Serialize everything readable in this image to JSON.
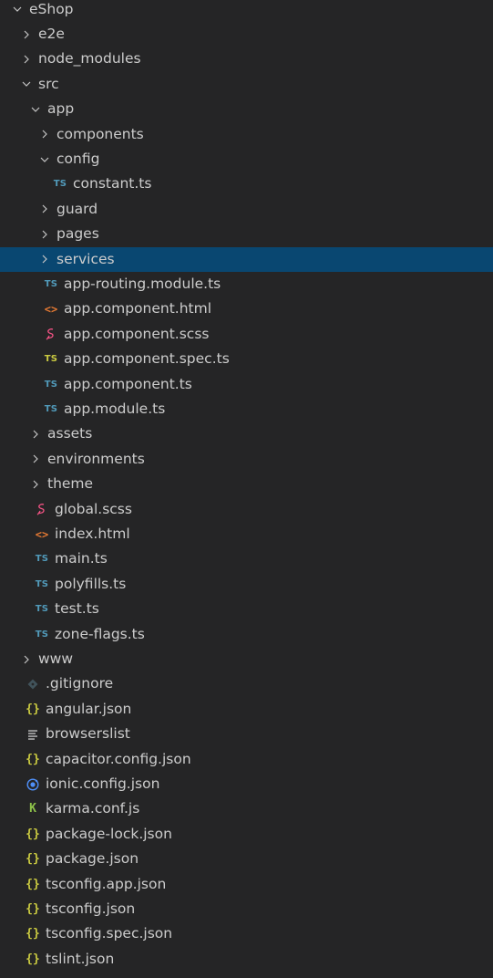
{
  "colors": {
    "background": "#252526",
    "selected": "#094771",
    "text": "#cccccc",
    "ts_blue": "#519aba",
    "ts_yellow": "#cbcb41",
    "json_yellow": "#cbcb41",
    "html_orange": "#e37933",
    "scss_pink": "#f55385",
    "karma_green": "#8dc149",
    "ionic_blue": "#4f8ff7"
  },
  "tree": [
    {
      "label": "eShop",
      "depth": 0,
      "kind": "folder",
      "open": true
    },
    {
      "label": "e2e",
      "depth": 1,
      "kind": "folder",
      "open": false
    },
    {
      "label": "node_modules",
      "depth": 1,
      "kind": "folder",
      "open": false
    },
    {
      "label": "src",
      "depth": 1,
      "kind": "folder",
      "open": true
    },
    {
      "label": "app",
      "depth": 2,
      "kind": "folder",
      "open": true
    },
    {
      "label": "components",
      "depth": 3,
      "kind": "folder",
      "open": false
    },
    {
      "label": "config",
      "depth": 3,
      "kind": "folder",
      "open": true
    },
    {
      "label": "constant.ts",
      "depth": 4,
      "kind": "file",
      "icon": "ts-icon",
      "icon_text": "TS",
      "icon_color": "#519aba"
    },
    {
      "label": "guard",
      "depth": 3,
      "kind": "folder",
      "open": false
    },
    {
      "label": "pages",
      "depth": 3,
      "kind": "folder",
      "open": false
    },
    {
      "label": "services",
      "depth": 3,
      "kind": "folder",
      "open": false,
      "selected": true
    },
    {
      "label": "app-routing.module.ts",
      "depth": 3,
      "kind": "file",
      "icon": "ts-icon",
      "icon_text": "TS",
      "icon_color": "#519aba"
    },
    {
      "label": "app.component.html",
      "depth": 3,
      "kind": "file",
      "icon": "html-icon",
      "icon_text": "<>",
      "icon_color": "#e37933"
    },
    {
      "label": "app.component.scss",
      "depth": 3,
      "kind": "file",
      "icon": "scss-icon",
      "icon_color": "#f55385"
    },
    {
      "label": "app.component.spec.ts",
      "depth": 3,
      "kind": "file",
      "icon": "spec-ts-icon",
      "icon_text": "TS",
      "icon_color": "#cbcb41"
    },
    {
      "label": "app.component.ts",
      "depth": 3,
      "kind": "file",
      "icon": "ts-icon",
      "icon_text": "TS",
      "icon_color": "#519aba"
    },
    {
      "label": "app.module.ts",
      "depth": 3,
      "kind": "file",
      "icon": "ts-icon",
      "icon_text": "TS",
      "icon_color": "#519aba"
    },
    {
      "label": "assets",
      "depth": 2,
      "kind": "folder",
      "open": false
    },
    {
      "label": "environments",
      "depth": 2,
      "kind": "folder",
      "open": false
    },
    {
      "label": "theme",
      "depth": 2,
      "kind": "folder",
      "open": false
    },
    {
      "label": "global.scss",
      "depth": 2,
      "kind": "file",
      "icon": "scss-icon",
      "icon_color": "#f55385"
    },
    {
      "label": "index.html",
      "depth": 2,
      "kind": "file",
      "icon": "html-icon",
      "icon_text": "<>",
      "icon_color": "#e37933"
    },
    {
      "label": "main.ts",
      "depth": 2,
      "kind": "file",
      "icon": "ts-icon",
      "icon_text": "TS",
      "icon_color": "#519aba"
    },
    {
      "label": "polyfills.ts",
      "depth": 2,
      "kind": "file",
      "icon": "ts-icon",
      "icon_text": "TS",
      "icon_color": "#519aba"
    },
    {
      "label": "test.ts",
      "depth": 2,
      "kind": "file",
      "icon": "ts-icon",
      "icon_text": "TS",
      "icon_color": "#519aba"
    },
    {
      "label": "zone-flags.ts",
      "depth": 2,
      "kind": "file",
      "icon": "ts-icon",
      "icon_text": "TS",
      "icon_color": "#519aba"
    },
    {
      "label": "www",
      "depth": 1,
      "kind": "folder",
      "open": false
    },
    {
      "label": ".gitignore",
      "depth": 1,
      "kind": "file",
      "icon": "git-icon",
      "icon_color": "#41535b"
    },
    {
      "label": "angular.json",
      "depth": 1,
      "kind": "file",
      "icon": "json-icon",
      "icon_text": "{}",
      "icon_color": "#cbcb41"
    },
    {
      "label": "browserslist",
      "depth": 1,
      "kind": "file",
      "icon": "list-icon",
      "icon_color": "#cccccc"
    },
    {
      "label": "capacitor.config.json",
      "depth": 1,
      "kind": "file",
      "icon": "json-icon",
      "icon_text": "{}",
      "icon_color": "#cbcb41"
    },
    {
      "label": "ionic.config.json",
      "depth": 1,
      "kind": "file",
      "icon": "ionic-icon",
      "icon_color": "#4f8ff7"
    },
    {
      "label": "karma.conf.js",
      "depth": 1,
      "kind": "file",
      "icon": "karma-icon",
      "icon_text": "K",
      "icon_color": "#8dc149"
    },
    {
      "label": "package-lock.json",
      "depth": 1,
      "kind": "file",
      "icon": "json-icon",
      "icon_text": "{}",
      "icon_color": "#cbcb41"
    },
    {
      "label": "package.json",
      "depth": 1,
      "kind": "file",
      "icon": "json-icon",
      "icon_text": "{}",
      "icon_color": "#cbcb41"
    },
    {
      "label": "tsconfig.app.json",
      "depth": 1,
      "kind": "file",
      "icon": "json-icon",
      "icon_text": "{}",
      "icon_color": "#cbcb41"
    },
    {
      "label": "tsconfig.json",
      "depth": 1,
      "kind": "file",
      "icon": "json-icon",
      "icon_text": "{}",
      "icon_color": "#cbcb41"
    },
    {
      "label": "tsconfig.spec.json",
      "depth": 1,
      "kind": "file",
      "icon": "json-icon",
      "icon_text": "{}",
      "icon_color": "#cbcb41"
    },
    {
      "label": "tslint.json",
      "depth": 1,
      "kind": "file",
      "icon": "json-icon",
      "icon_text": "{}",
      "icon_color": "#cbcb41"
    }
  ]
}
